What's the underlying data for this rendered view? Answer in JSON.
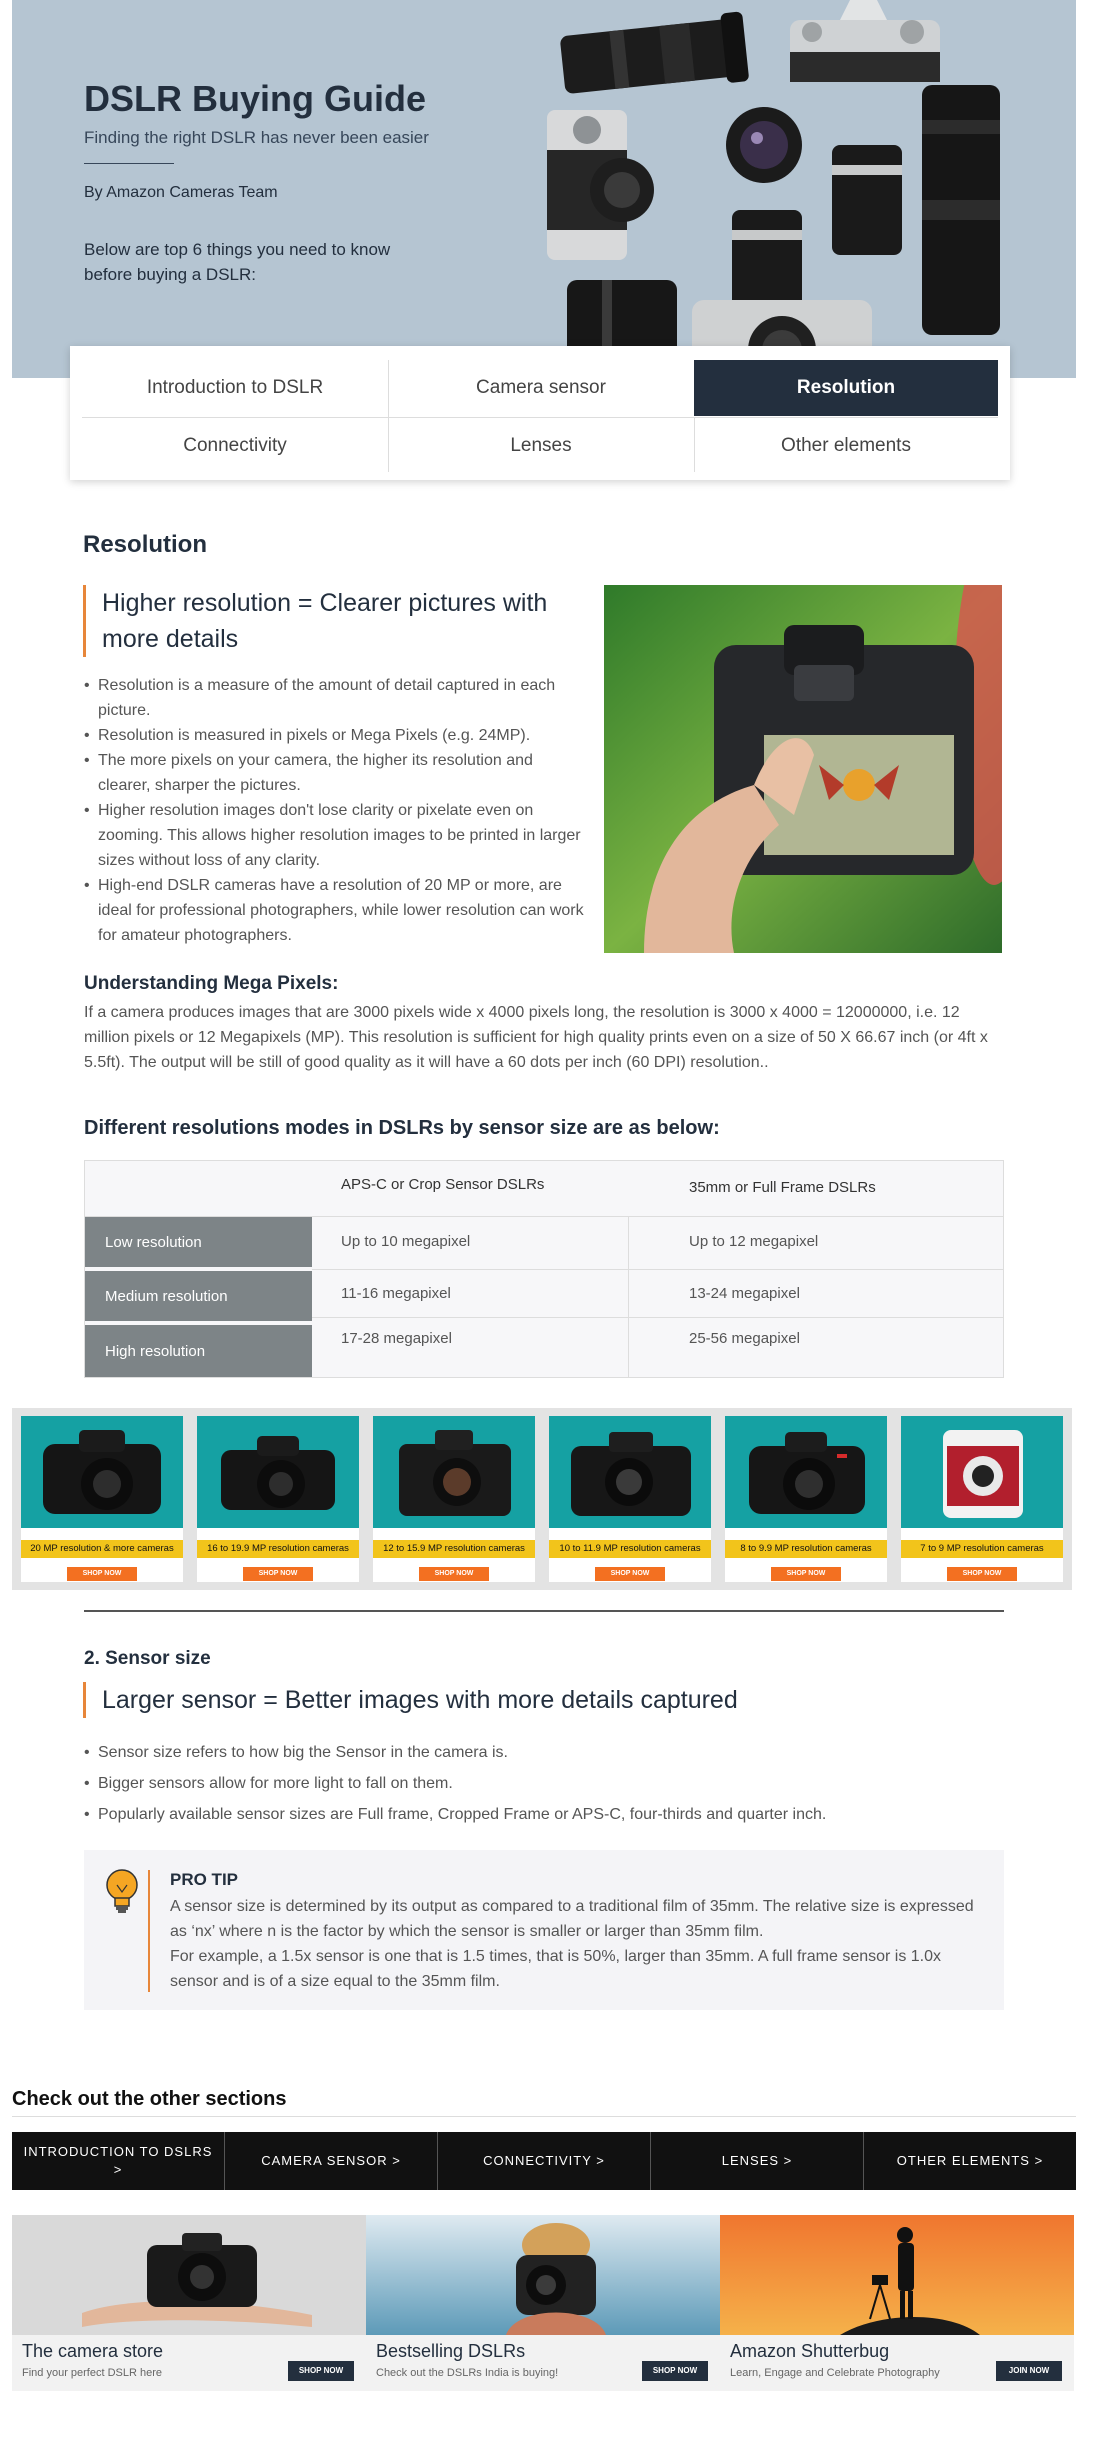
{
  "hero": {
    "title": "DSLR Buying Guide",
    "subtitle": "Finding the right DSLR has never been easier",
    "author": "By Amazon Cameras Team",
    "intro": "Below are top 6 things you need to know before buying a DSLR:"
  },
  "tabs": {
    "intro": "Introduction to DSLR",
    "sensor": "Camera sensor",
    "resolution": "Resolution",
    "connectivity": "Connectivity",
    "lenses": "Lenses",
    "other": "Other elements",
    "active": "Resolution"
  },
  "resolution": {
    "heading": "Resolution",
    "callout": "Higher resolution = Clearer pictures with more details",
    "bullets": [
      "Resolution is a measure of the amount of detail captured in each picture.",
      "Resolution is measured in pixels or Mega Pixels (e.g. 24MP).",
      "The more pixels on your camera, the higher its resolution and clearer, sharper the pictures.",
      "Higher resolution images don't lose clarity or pixelate even on zooming. This allows higher resolution images to be printed in larger sizes without loss of any clarity.",
      "High-end DSLR cameras have a resolution of 20 MP or more, are ideal for professional photographers, while lower resolution can work for amateur photographers."
    ],
    "mp_title": "Understanding Mega Pixels:",
    "mp_text": "If a camera produces images that are 3000 pixels wide x 4000 pixels long, the resolution is 3000 x 4000 = 12000000, i.e. 12 million pixels or 12 Megapixels (MP). This resolution is sufficient for high quality prints even on a size of 50 X 66.67 inch (or 4ft x  5.5ft). The output will be still of good quality as it will have a 60 dots per inch (60 DPI) resolution.."
  },
  "table": {
    "title": "Different resolutions modes in DSLRs by sensor size are as below:",
    "col1": "APS-C or Crop Sensor DSLRs",
    "col2": "35mm or Full Frame DSLRs",
    "rows": [
      {
        "label": "Low resolution",
        "a": "Up to 10 megapixel",
        "b": "Up to 12 megapixel"
      },
      {
        "label": "Medium resolution",
        "a": "11-16 megapixel",
        "b": "13-24 megapixel"
      },
      {
        "label": "High resolution",
        "a": "17-28 megapixel",
        "b": "25-56 megapixel"
      }
    ]
  },
  "products": [
    {
      "banner": "20 MP resolution & more cameras",
      "button": "SHOP NOW"
    },
    {
      "banner": "16 to 19.9 MP resolution cameras",
      "button": "SHOP NOW"
    },
    {
      "banner": "12 to 15.9 MP resolution cameras",
      "button": "SHOP NOW"
    },
    {
      "banner": "10 to 11.9 MP resolution cameras",
      "button": "SHOP NOW"
    },
    {
      "banner": "8 to 9.9 MP resolution cameras",
      "button": "SHOP NOW"
    },
    {
      "banner": "7 to 9 MP resolution cameras",
      "button": "SHOP NOW"
    }
  ],
  "sensor": {
    "heading": "2. Sensor size",
    "callout": "Larger sensor = Better images with more details captured",
    "bullets": [
      "Sensor size refers to how big the Sensor in the camera is.",
      "Bigger sensors allow for more light to fall on them.",
      "Popularly available sensor sizes are Full frame, Cropped Frame or APS-C, four-thirds and quarter inch."
    ],
    "tip_title": "PRO TIP",
    "tip_text1": "A sensor size is determined by its output as compared to a traditional film of 35mm. The relative size is expressed as ‘nx’ where n is the factor by which the sensor is smaller or larger than 35mm film.",
    "tip_text2": "For example, a 1.5x sensor is one that is 1.5 times, that is 50%, larger than 35mm. A full frame sensor is 1.0x sensor and is of a size equal to the 35mm film."
  },
  "checkout": {
    "title": "Check out the other sections",
    "nav": [
      "INTRODUCTION TO DSLRS >",
      "CAMERA SENSOR >",
      "CONNECTIVITY >",
      "LENSES >",
      "OTHER ELEMENTS >"
    ]
  },
  "promos": [
    {
      "title": "The camera store",
      "sub": "Find your perfect DSLR here",
      "button": "SHOP NOW"
    },
    {
      "title": "Bestselling DSLRs",
      "sub": "Check out the DSLRs India is buying!",
      "button": "SHOP NOW"
    },
    {
      "title": "Amazon Shutterbug",
      "sub": "Learn, Engage and Celebrate Photography",
      "button": "JOIN NOW"
    }
  ],
  "colors": {
    "navy": "#232f3e",
    "accent_orange": "#e7863a",
    "banner_yellow": "#f2c41b",
    "teal": "#15a1a3",
    "shop_orange": "#f37021"
  }
}
